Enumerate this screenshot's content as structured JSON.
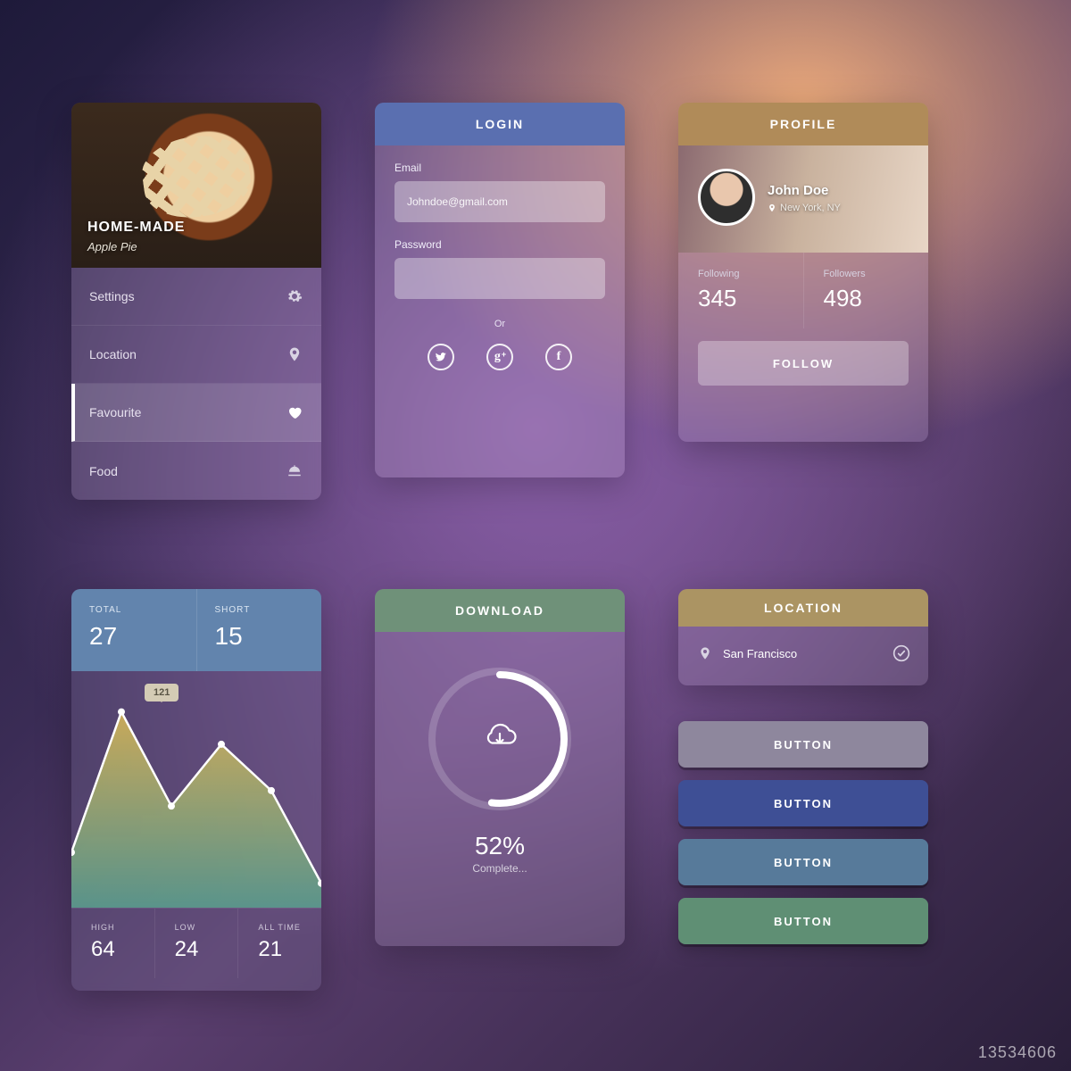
{
  "watermark": "13534606",
  "nav": {
    "hero_title": "HOME-MADE",
    "hero_subtitle": "Apple Pie",
    "items": [
      {
        "label": "Settings",
        "icon": "gear-icon",
        "active": false
      },
      {
        "label": "Location",
        "icon": "pin-icon",
        "active": false
      },
      {
        "label": "Favourite",
        "icon": "heart-icon",
        "active": true
      },
      {
        "label": "Food",
        "icon": "cloche-icon",
        "active": false
      }
    ]
  },
  "login": {
    "header": "LOGIN",
    "email_label": "Email",
    "email_placeholder": "Johndoe@gmail.com",
    "password_label": "Password",
    "password_value": "",
    "or_label": "Or",
    "socials": [
      "twitter",
      "google-plus",
      "facebook"
    ]
  },
  "profile": {
    "header": "PROFILE",
    "name": "John Doe",
    "location": "New York, NY",
    "following_label": "Following",
    "following_value": "345",
    "followers_label": "Followers",
    "followers_value": "498",
    "follow_button": "FOLLOW"
  },
  "stats": {
    "top": [
      {
        "label": "TOTAL",
        "value": "27"
      },
      {
        "label": "SHORT",
        "value": "15"
      }
    ],
    "tooltip_value": "121",
    "bottom": [
      {
        "label": "HIGH",
        "value": "64"
      },
      {
        "label": "LOW",
        "value": "24"
      },
      {
        "label": "ALL TIME",
        "value": "21"
      }
    ]
  },
  "chart_data": {
    "type": "line",
    "title": "",
    "xlabel": "",
    "ylabel": "",
    "x": [
      0,
      1,
      2,
      3,
      4,
      5
    ],
    "values": [
      30,
      121,
      60,
      100,
      70,
      10
    ],
    "ylim": [
      0,
      130
    ],
    "annotations": [
      {
        "x": 1,
        "y": 121,
        "text": "121"
      }
    ],
    "style": {
      "area_fill": true,
      "gradient": [
        "#d7b75a",
        "#5aa18e"
      ],
      "line_color": "#ffffff",
      "markers": true
    }
  },
  "download": {
    "header": "DOWNLOAD",
    "percent": "52%",
    "percent_label": "Complete...",
    "progress_value": 52
  },
  "location": {
    "header": "LOCATION",
    "city": "San Francisco"
  },
  "buttons": [
    {
      "label": "BUTTON",
      "color": "#8e879d"
    },
    {
      "label": "BUTTON",
      "color": "#3e4f95"
    },
    {
      "label": "BUTTON",
      "color": "#577a9a"
    },
    {
      "label": "BUTTON",
      "color": "#5f8f74"
    }
  ]
}
